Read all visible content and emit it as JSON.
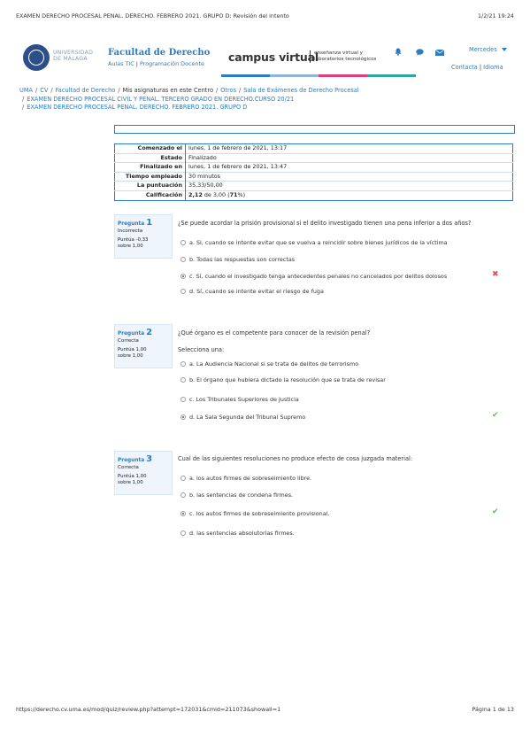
{
  "print": {
    "header_title": "EXAMEN DERECHO PROCESAL PENAL. DERECHO. FEBRERO 2021. GRUPO D: Revisión del intento",
    "header_date": "1/2/21 19:24",
    "footer_url": "https://derecho.cv.uma.es/mod/quiz/review.php?attempt=172031&cmid=211073&showall=1",
    "footer_page": "Página 1 de 13"
  },
  "brand": {
    "uni_line1": "UNIVERSIDAD",
    "uni_line2": "DE MÁLAGA",
    "faculty_title": "Facultad de Derecho",
    "faculty_link1": "Aulas TIC",
    "faculty_link_sep": "|",
    "faculty_link2": "Programación Docente",
    "cv_title": "campus virtual",
    "cv_sub1": "enseñanza virtual y",
    "cv_sub2": "laboratorios tecnológicos",
    "stripe_colors": [
      "#2c7cc1",
      "#8fb3d9",
      "#e0407a",
      "#2aa7a0"
    ]
  },
  "user": {
    "name": "Mercedes",
    "contact_label": "Contacta",
    "link_sep": "|",
    "language_label": "Idioma"
  },
  "breadcrumb": {
    "items": [
      "UMA",
      "CV",
      "Facultad de Derecho",
      "Mis asignaturas en este Centro",
      "Otros",
      "Sala de Exámenes de Derecho Procesal",
      "EXAMEN DERECHO PROCESAL CIVIL Y PENAL. TERCERO GRADO EN DERECHO.CURSO 20/21",
      "EXAMEN DERECHO PROCESAL PENAL. DERECHO. FEBRERO 2021. GRUPO D"
    ],
    "sep": "/"
  },
  "summary": {
    "rows": [
      {
        "key": "Comenzado el",
        "value": "lunes, 1 de febrero de 2021, 13:17"
      },
      {
        "key": "Estado",
        "value": "Finalizado"
      },
      {
        "key": "Finalizado en",
        "value": "lunes, 1 de febrero de 2021, 13:47"
      },
      {
        "key": "Tiempo empleado",
        "value": "30 minutos"
      },
      {
        "key": "La puntuación",
        "value": "35,33/50,00"
      }
    ],
    "grade_key": "Calificación",
    "grade_value": "2,12",
    "grade_mid": " de 3,00 (",
    "grade_pct": "71",
    "grade_end": "%)"
  },
  "questions": [
    {
      "label": "Pregunta",
      "number": "1",
      "state": "Incorrecta",
      "mark_line1": "Puntúa -0,33",
      "mark_line2": "sobre 1,00",
      "text": "¿Se puede acordar la prisión provisional si el delito investigado tienen una pena inferior a dos años?",
      "prompt": "",
      "options": [
        {
          "text": "a. Si, cuando se intente evitar que se vuelva a reincidir sobre bienes jurídicos de la víctima",
          "selected": false
        },
        {
          "text": "b. Todas las respuestas son correctas",
          "selected": false
        },
        {
          "text": "c. Sí, cuando el investigado tenga antecedentes penales no cancelados por delitos dolosos",
          "selected": true,
          "feedback": "wrong"
        },
        {
          "text": "d. Sí, cuando se intente evitar el riesgo de fuga",
          "selected": false
        }
      ]
    },
    {
      "label": "Pregunta",
      "number": "2",
      "state": "Correcta",
      "mark_line1": "Puntúa 1,00",
      "mark_line2": "sobre 1,00",
      "text": "¿Qué órgano es el competente para conocer de la revisión penal?",
      "prompt": "Selecciona una:",
      "options": [
        {
          "text": "a. La Audiencia Nacional si se trata de delitos de terrorismo",
          "selected": false
        },
        {
          "text": "b. El órgano que hubiera dictado la resolución que se trata de revisar",
          "selected": false
        },
        {
          "text": "c. Los Tribunales Superiores de Justicia",
          "selected": false
        },
        {
          "text": "d. La Sala Segunda del Tribunal Supremo",
          "selected": true,
          "feedback": "right"
        }
      ]
    },
    {
      "label": "Pregunta",
      "number": "3",
      "state": "Correcta",
      "mark_line1": "Puntúa 1,00",
      "mark_line2": "sobre 1,00",
      "text": "Cual de las siguientes resoluciones no produce efecto de cosa juzgada material:",
      "prompt": "",
      "options": [
        {
          "text": "a. los autos firmes de sobreseimiento libre.",
          "selected": false
        },
        {
          "text": "b. las sentencias  de condena firmes.",
          "selected": false
        },
        {
          "text": "c. los autos firmes de sobreseimiento provisional.",
          "selected": true,
          "feedback": "right"
        },
        {
          "text": "d. las sentencias absolutorias firmes.",
          "selected": false
        }
      ]
    }
  ]
}
